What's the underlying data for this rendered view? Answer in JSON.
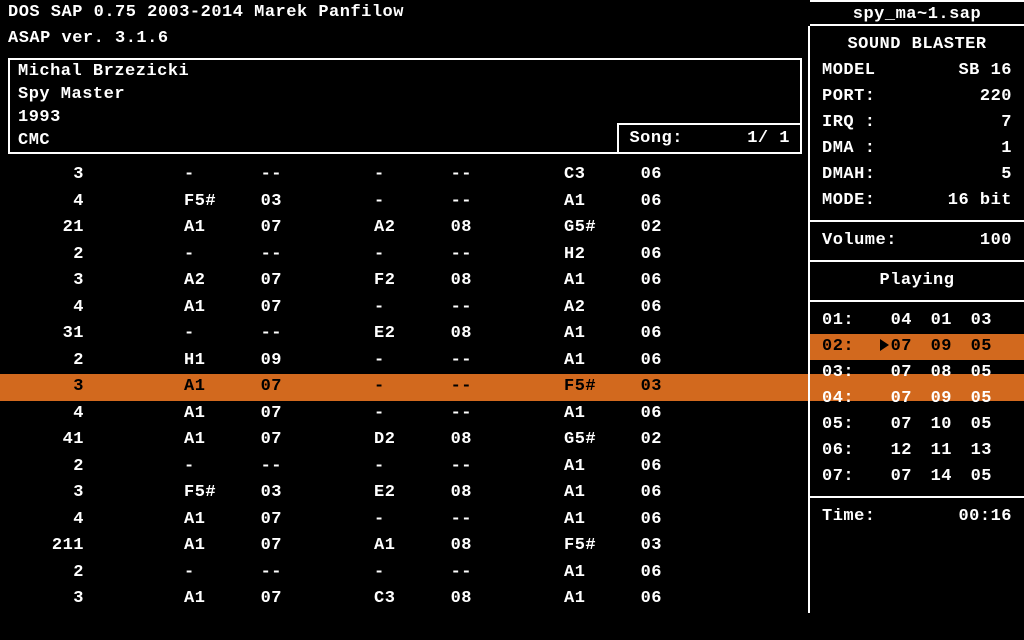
{
  "header": {
    "line1": "DOS SAP 0.75   2003-2014 Marek Panfilow",
    "line2": "ASAP ver. 3.1.6"
  },
  "filename": "spy_ma~1.sap",
  "info": {
    "author": "Michal Brzezicki",
    "title": "Spy Master",
    "year": "1993",
    "format": "CMC",
    "song_label": "Song:",
    "song_value": "1/ 1"
  },
  "hw": {
    "title": "SOUND BLASTER",
    "model_k": "MODEL",
    "model_v": "SB 16",
    "port_k": "PORT:",
    "port_v": "220",
    "irq_k": "IRQ :",
    "irq_v": "7",
    "dma_k": "DMA :",
    "dma_v": "1",
    "dmah_k": "DMAH:",
    "dmah_v": "5",
    "mode_k": "MODE:",
    "mode_v": "16 bit"
  },
  "volume_k": "Volume:",
  "volume_v": "100",
  "status": "Playing",
  "channels": [
    {
      "n": "01:",
      "a": "04",
      "b": "01",
      "c": "03",
      "hl": false
    },
    {
      "n": "02:",
      "a": "07",
      "b": "09",
      "c": "05",
      "hl": true
    },
    {
      "n": "03:",
      "a": "07",
      "b": "08",
      "c": "05",
      "hl": false
    },
    {
      "n": "04:",
      "a": "07",
      "b": "09",
      "c": "05",
      "hl": false
    },
    {
      "n": "05:",
      "a": "07",
      "b": "10",
      "c": "05",
      "hl": false
    },
    {
      "n": "06:",
      "a": "12",
      "b": "11",
      "c": "13",
      "hl": false
    },
    {
      "n": "07:",
      "a": "07",
      "b": "14",
      "c": "05",
      "hl": false
    }
  ],
  "time_k": "Time:",
  "time_v": "00:16",
  "pattern": [
    {
      "r": "3",
      "n1": "-",
      "i1": "--",
      "n2": "-",
      "i2": "--",
      "n3": "C3",
      "i3": "06",
      "hl": false
    },
    {
      "r": "4",
      "n1": "F5#",
      "i1": "03",
      "n2": "-",
      "i2": "--",
      "n3": "A1",
      "i3": "06",
      "hl": false
    },
    {
      "r": "21",
      "n1": "A1",
      "i1": "07",
      "n2": "A2",
      "i2": "08",
      "n3": "G5#",
      "i3": "02",
      "hl": false
    },
    {
      "r": "2",
      "n1": "-",
      "i1": "--",
      "n2": "-",
      "i2": "--",
      "n3": "H2",
      "i3": "06",
      "hl": false
    },
    {
      "r": "3",
      "n1": "A2",
      "i1": "07",
      "n2": "F2",
      "i2": "08",
      "n3": "A1",
      "i3": "06",
      "hl": false
    },
    {
      "r": "4",
      "n1": "A1",
      "i1": "07",
      "n2": "-",
      "i2": "--",
      "n3": "A2",
      "i3": "06",
      "hl": false
    },
    {
      "r": "31",
      "n1": "-",
      "i1": "--",
      "n2": "E2",
      "i2": "08",
      "n3": "A1",
      "i3": "06",
      "hl": false
    },
    {
      "r": "2",
      "n1": "H1",
      "i1": "09",
      "n2": "-",
      "i2": "--",
      "n3": "A1",
      "i3": "06",
      "hl": false
    },
    {
      "r": "3",
      "n1": "A1",
      "i1": "07",
      "n2": "-",
      "i2": "--",
      "n3": "F5#",
      "i3": "03",
      "hl": true
    },
    {
      "r": "4",
      "n1": "A1",
      "i1": "07",
      "n2": "-",
      "i2": "--",
      "n3": "A1",
      "i3": "06",
      "hl": false
    },
    {
      "r": "41",
      "n1": "A1",
      "i1": "07",
      "n2": "D2",
      "i2": "08",
      "n3": "G5#",
      "i3": "02",
      "hl": false
    },
    {
      "r": "2",
      "n1": "-",
      "i1": "--",
      "n2": "-",
      "i2": "--",
      "n3": "A1",
      "i3": "06",
      "hl": false
    },
    {
      "r": "3",
      "n1": "F5#",
      "i1": "03",
      "n2": "E2",
      "i2": "08",
      "n3": "A1",
      "i3": "06",
      "hl": false
    },
    {
      "r": "4",
      "n1": "A1",
      "i1": "07",
      "n2": "-",
      "i2": "--",
      "n3": "A1",
      "i3": "06",
      "hl": false
    },
    {
      "r": "211",
      "n1": "A1",
      "i1": "07",
      "n2": "A1",
      "i2": "08",
      "n3": "F5#",
      "i3": "03",
      "hl": false
    },
    {
      "r": "2",
      "n1": "-",
      "i1": "--",
      "n2": "-",
      "i2": "--",
      "n3": "A1",
      "i3": "06",
      "hl": false
    },
    {
      "r": "3",
      "n1": "A1",
      "i1": "07",
      "n2": "C3",
      "i2": "08",
      "n3": "A1",
      "i3": "06",
      "hl": false
    }
  ]
}
